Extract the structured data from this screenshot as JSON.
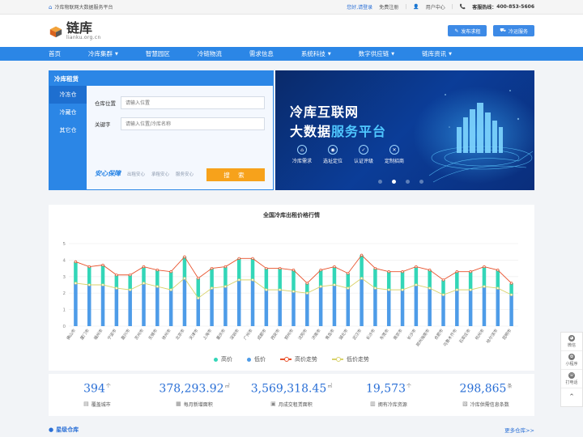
{
  "topbar": {
    "site_name": "冷库物联网大数据服务平台",
    "login_text": "您好,请登录",
    "register": "免费注册",
    "user_center": "用户中心",
    "hotline_label": "客服热线：",
    "hotline": "400-853-5606"
  },
  "logo": {
    "cn": "链库",
    "en": "lianku.org.cn"
  },
  "header_buttons": [
    {
      "label": "发布求租",
      "icon": "edit-icon"
    },
    {
      "label": "冷运服务",
      "icon": "truck-icon"
    }
  ],
  "nav": [
    {
      "label": "首页",
      "dropdown": false
    },
    {
      "label": "冷库集群",
      "dropdown": true
    },
    {
      "label": "智慧园区",
      "dropdown": false
    },
    {
      "label": "冷链物流",
      "dropdown": false
    },
    {
      "label": "需求信息",
      "dropdown": false
    },
    {
      "label": "系统科技",
      "dropdown": true
    },
    {
      "label": "数字供应链",
      "dropdown": true
    },
    {
      "label": "链库资讯",
      "dropdown": true
    }
  ],
  "search": {
    "title": "冷库租赁",
    "tabs": [
      "冷冻仓",
      "冷藏仓",
      "其它仓"
    ],
    "active_tab": 0,
    "location_label": "仓库位置",
    "location_placeholder": "请输入位置",
    "keyword_label": "关键字",
    "keyword_placeholder": "请输入位置/冷库名称",
    "guarantee": "安心保障",
    "guarantee_items": [
      "出租安心",
      "承租安心",
      "服务安心"
    ],
    "button": "搜 索"
  },
  "banner": {
    "line1": "冷库互联网",
    "line2a": "大数据",
    "line2b": "服务平台",
    "features": [
      {
        "label": "冷库需求",
        "icon": "home-icon"
      },
      {
        "label": "选址定位",
        "icon": "location-icon"
      },
      {
        "label": "认证评级",
        "icon": "shield-icon"
      },
      {
        "label": "定制招商",
        "icon": "tools-icon"
      }
    ],
    "active_dot": 1
  },
  "chart_data": {
    "type": "line",
    "title": "全国冷库出租价格行情",
    "ylim": [
      0,
      5
    ],
    "yticks": [
      0,
      1,
      2,
      3,
      4,
      5
    ],
    "grid": true,
    "legend_position": "bottom",
    "categories": [
      "佛山市",
      "厦门市",
      "福州市",
      "宁波市",
      "嘉兴市",
      "苏州市",
      "无锡市",
      "徐州市",
      "北京市",
      "天津市",
      "上海市",
      "重庆市",
      "深圳市",
      "广州市",
      "成都市",
      "西安市",
      "郑州市",
      "沈阳市",
      "济南市",
      "青岛市",
      "湖北市",
      "武汉市",
      "长沙市",
      "东莞市",
      "南京市",
      "长沙市",
      "郑州海南市",
      "合肥市",
      "乌鲁木齐市",
      "石家庄市",
      "杭州市",
      "哈尔滨市",
      "昆明市"
    ],
    "series": [
      {
        "name": "高价",
        "color": "#33d6b8",
        "values": [
          3.9,
          3.6,
          3.7,
          3.1,
          3.1,
          3.6,
          3.4,
          3.3,
          4.2,
          2.9,
          3.5,
          3.6,
          4.1,
          4.1,
          3.5,
          3.5,
          3.4,
          2.6,
          3.4,
          3.6,
          3.2,
          4.3,
          3.5,
          3.3,
          3.3,
          3.6,
          3.4,
          2.8,
          3.3,
          3.3,
          3.6,
          3.4,
          2.6
        ]
      },
      {
        "name": "低价",
        "color": "#4e9ce8",
        "values": [
          2.6,
          2.5,
          2.5,
          2.3,
          2.2,
          2.6,
          2.4,
          2.2,
          2.9,
          1.7,
          2.3,
          2.4,
          2.8,
          2.8,
          2.2,
          2.2,
          2.1,
          2.0,
          2.4,
          2.5,
          2.3,
          2.9,
          2.3,
          2.2,
          2.2,
          2.5,
          2.3,
          1.9,
          2.2,
          2.2,
          2.4,
          2.3,
          1.9
        ]
      },
      {
        "name": "高价走势",
        "color": "#e8502a",
        "values": [
          3.9,
          3.6,
          3.7,
          3.1,
          3.1,
          3.6,
          3.4,
          3.3,
          4.2,
          2.9,
          3.5,
          3.6,
          4.1,
          4.1,
          3.5,
          3.5,
          3.4,
          2.6,
          3.4,
          3.6,
          3.2,
          4.3,
          3.5,
          3.3,
          3.3,
          3.6,
          3.4,
          2.8,
          3.3,
          3.3,
          3.6,
          3.4,
          2.6
        ]
      },
      {
        "name": "低价走势",
        "color": "#d9d26a",
        "values": [
          2.6,
          2.5,
          2.5,
          2.3,
          2.2,
          2.6,
          2.4,
          2.2,
          2.9,
          1.7,
          2.3,
          2.4,
          2.8,
          2.8,
          2.2,
          2.2,
          2.1,
          2.0,
          2.4,
          2.5,
          2.3,
          2.9,
          2.3,
          2.2,
          2.2,
          2.5,
          2.3,
          1.9,
          2.2,
          2.2,
          2.4,
          2.3,
          1.9
        ]
      }
    ]
  },
  "stats": [
    {
      "value": "394",
      "unit": "个",
      "label": "覆盖城市",
      "icon": "map-icon"
    },
    {
      "value": "378,293.92",
      "unit": "㎡",
      "label": "每月新增面积",
      "icon": "chart-icon"
    },
    {
      "value": "3,569,318.45",
      "unit": "㎡",
      "label": "月成交租赁面积",
      "icon": "document-icon"
    },
    {
      "value": "19,573",
      "unit": "个",
      "label": "拥有冷库资源",
      "icon": "warehouse-icon"
    },
    {
      "value": "298,865",
      "unit": "条",
      "label": "冷库供需信息条数",
      "icon": "list-icon"
    }
  ],
  "bottom": {
    "heading": "星级仓库",
    "more": "更多仓库>>"
  },
  "float_panel": [
    {
      "label": "微信",
      "icon": "wechat-icon"
    },
    {
      "label": "小程序",
      "icon": "miniprogram-icon"
    },
    {
      "label": "打电话",
      "icon": "phone-icon"
    }
  ],
  "colors": {
    "primary": "#2b86e6",
    "accent": "#f7a21b"
  }
}
